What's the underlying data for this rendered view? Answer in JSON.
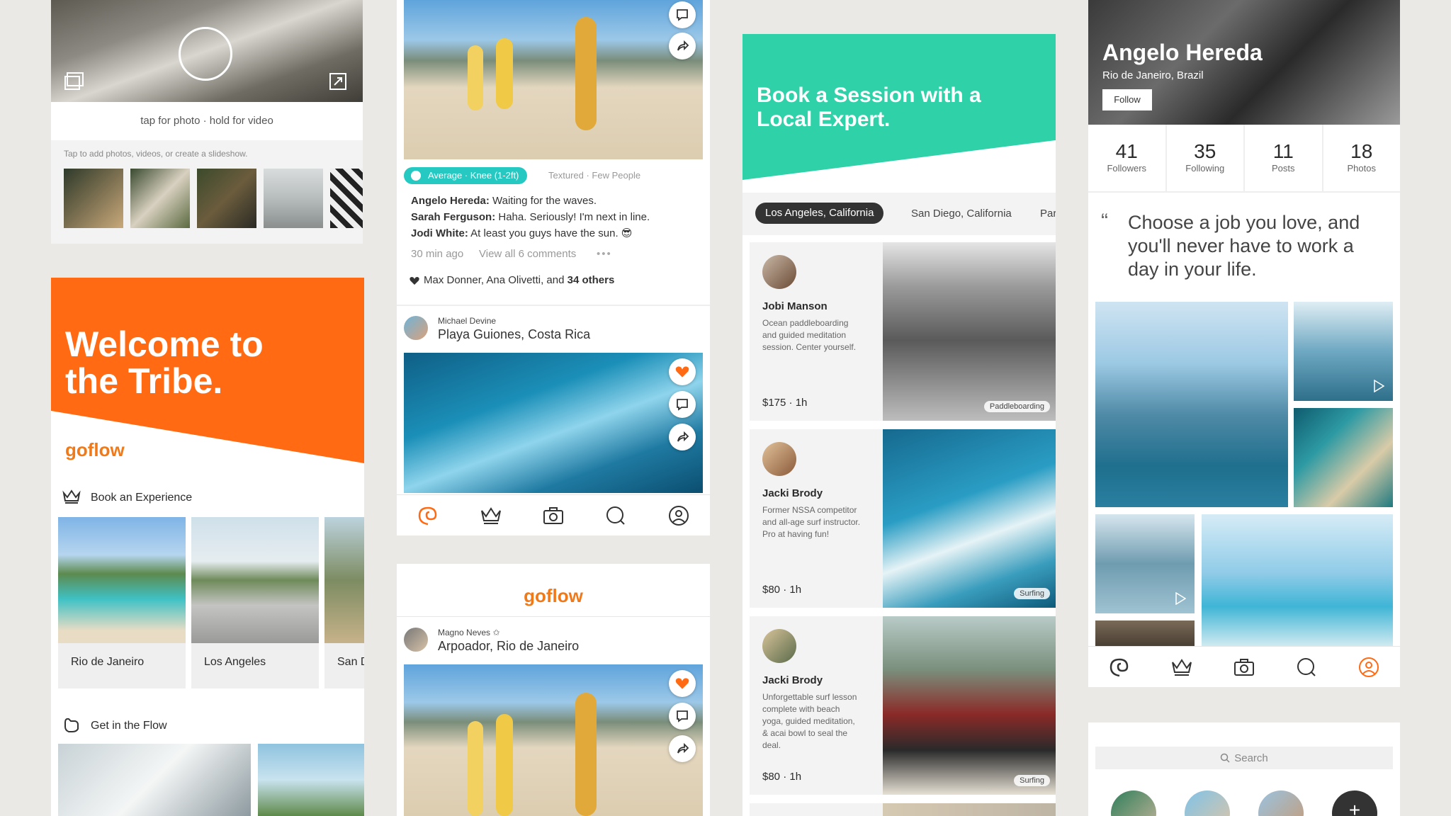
{
  "camera": {
    "capture_hint": "tap for photo · hold for video",
    "add_hint": "Tap to add photos, videos, or create a slideshow."
  },
  "welcome": {
    "headline_line1": "Welcome to",
    "headline_line2": "the Tribe.",
    "brand": "goflow",
    "book_section": "Book an Experience",
    "places": [
      "Rio de Janeiro",
      "Los Angeles",
      "San D"
    ],
    "flow_section": "Get in the Flow"
  },
  "feed": {
    "badge": "Average · Knee (1-2ft)",
    "conditions": "Textured · Few People",
    "comments": [
      {
        "user": "Angelo Hereda:",
        "text": " Waiting for the waves."
      },
      {
        "user": "Sarah Ferguson:",
        "text": " Haha. Seriously! I'm next in line."
      },
      {
        "user": "Jodi White:",
        "text": " At least you guys have the sun. 😎"
      }
    ],
    "time": "30 min ago",
    "view_all": "View all 6 comments",
    "likes_names": "Max Donner, Ana Olivetti,",
    "likes_and": " and ",
    "likes_count": "34 others",
    "post2_user": "Michael Devine",
    "post2_place": "Playa Guiones, Costa Rica"
  },
  "feed2": {
    "brand": "goflow",
    "user": "Magno Neves",
    "place": "Arpoador, Rio de Janeiro"
  },
  "experts": {
    "headline_line1": "Book a Session with a",
    "headline_line2": "Local Expert.",
    "locations": [
      "Los Angeles, California",
      "San Diego, California",
      "Par"
    ],
    "items": [
      {
        "name": "Jobi Manson",
        "desc": "Ocean paddleboarding and guided meditation session. Center yourself.",
        "price": "$175 · 1h",
        "tag": "Paddleboarding"
      },
      {
        "name": "Jacki Brody",
        "desc": "Former NSSA competitor and all-age surf instructor. Pro at having fun!",
        "price": "$80 · 1h",
        "tag": "Surfing"
      },
      {
        "name": "Jacki Brody",
        "desc": "Unforgettable surf lesson complete with beach yoga, guided meditation, & acai bowl to seal the deal.",
        "price": "$80 · 1h",
        "tag": "Surfing"
      }
    ]
  },
  "profile": {
    "name": "Angelo Hereda",
    "location": "Rio de Janeiro, Brazil",
    "follow": "Follow",
    "stats": [
      {
        "value": "41",
        "label": "Followers"
      },
      {
        "value": "35",
        "label": "Following"
      },
      {
        "value": "11",
        "label": "Posts"
      },
      {
        "value": "18",
        "label": "Photos"
      }
    ],
    "quote": "Choose a job you love, and you'll never have to work a day in your life."
  },
  "search": {
    "placeholder": "Search"
  },
  "colors": {
    "orange": "#ff6a13",
    "teal": "#2fd1a8",
    "brand_text": "#f07a1a"
  }
}
